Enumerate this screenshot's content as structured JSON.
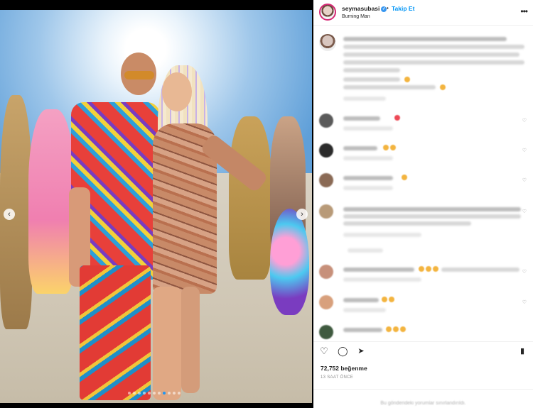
{
  "post": {
    "username": "seymasubasi",
    "follow_label": "Takip Et",
    "separator": "•",
    "location": "Burning Man",
    "verified_glyph": "✓",
    "more_glyph": "•••"
  },
  "carousel": {
    "prev_glyph": "‹",
    "next_glyph": "›",
    "slide_count": 11,
    "active_index": 7
  },
  "actions": {
    "like_icon": "heart-icon",
    "comment_icon": "comment-icon",
    "share_icon": "share-icon",
    "save_icon": "bookmark-icon",
    "like_glyph": "♡",
    "comment_glyph": "◯",
    "share_glyph": "➤",
    "save_glyph": "▮"
  },
  "likes_text": "72,752 beğenme",
  "time_text": "13 SAAT ÖNCE",
  "footer_text": "Bu gönderideki yorumlar sınırlandırıldı.",
  "colors": {
    "accent": "#0095f6",
    "text": "#262626",
    "muted": "#8e8e8e",
    "divider": "#efefef"
  }
}
